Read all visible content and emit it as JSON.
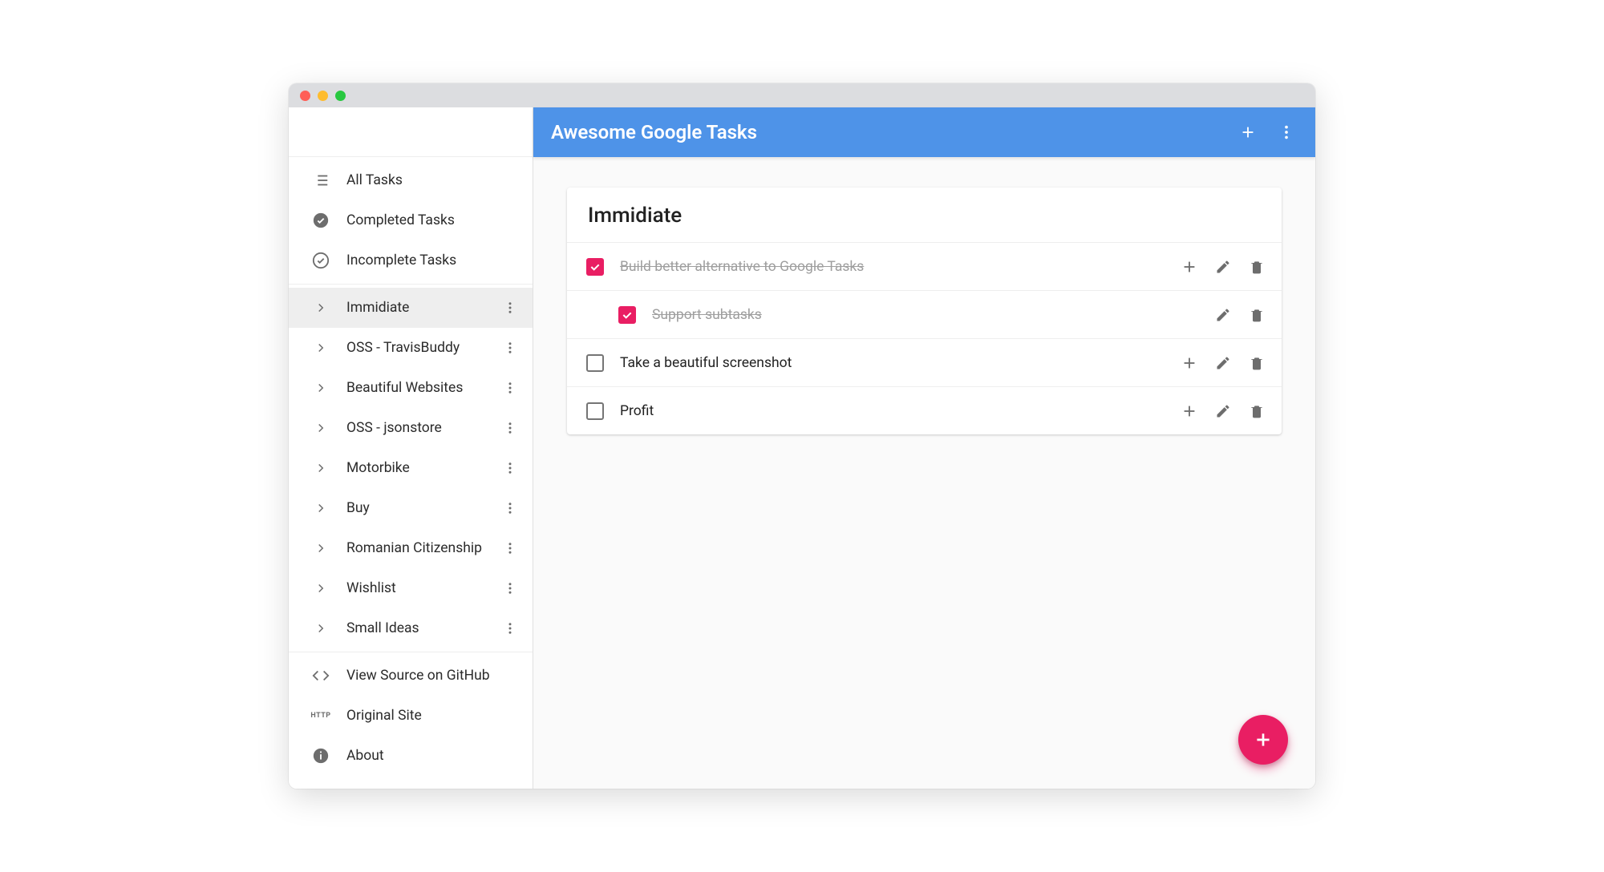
{
  "app_title": "Awesome Google Tasks",
  "accent_color": "#e91e63",
  "header_color": "#4e93e8",
  "sidebar": {
    "top": [
      {
        "icon": "list",
        "label": "All Tasks"
      },
      {
        "icon": "check-filled",
        "label": "Completed Tasks"
      },
      {
        "icon": "check-outline",
        "label": "Incomplete Tasks"
      }
    ],
    "lists": [
      {
        "label": "Immidiate",
        "active": true
      },
      {
        "label": "OSS - TravisBuddy",
        "active": false
      },
      {
        "label": "Beautiful Websites",
        "active": false
      },
      {
        "label": "OSS - jsonstore",
        "active": false
      },
      {
        "label": "Motorbike",
        "active": false
      },
      {
        "label": "Buy",
        "active": false
      },
      {
        "label": "Romanian Citizenship",
        "active": false
      },
      {
        "label": "Wishlist",
        "active": false
      },
      {
        "label": "Small Ideas",
        "active": false
      }
    ],
    "bottom": [
      {
        "icon": "code",
        "label": "View Source on GitHub"
      },
      {
        "icon": "http",
        "label": "Original Site"
      },
      {
        "icon": "info",
        "label": "About"
      }
    ]
  },
  "list_title": "Immidiate",
  "tasks": [
    {
      "checked": true,
      "sub": false,
      "text": "Build better alternative to Google Tasks",
      "has_add": true
    },
    {
      "checked": true,
      "sub": true,
      "text": "Support subtasks",
      "has_add": false
    },
    {
      "checked": false,
      "sub": false,
      "text": "Take a beautiful screenshot",
      "has_add": true
    },
    {
      "checked": false,
      "sub": false,
      "text": "Profit",
      "has_add": true
    }
  ]
}
